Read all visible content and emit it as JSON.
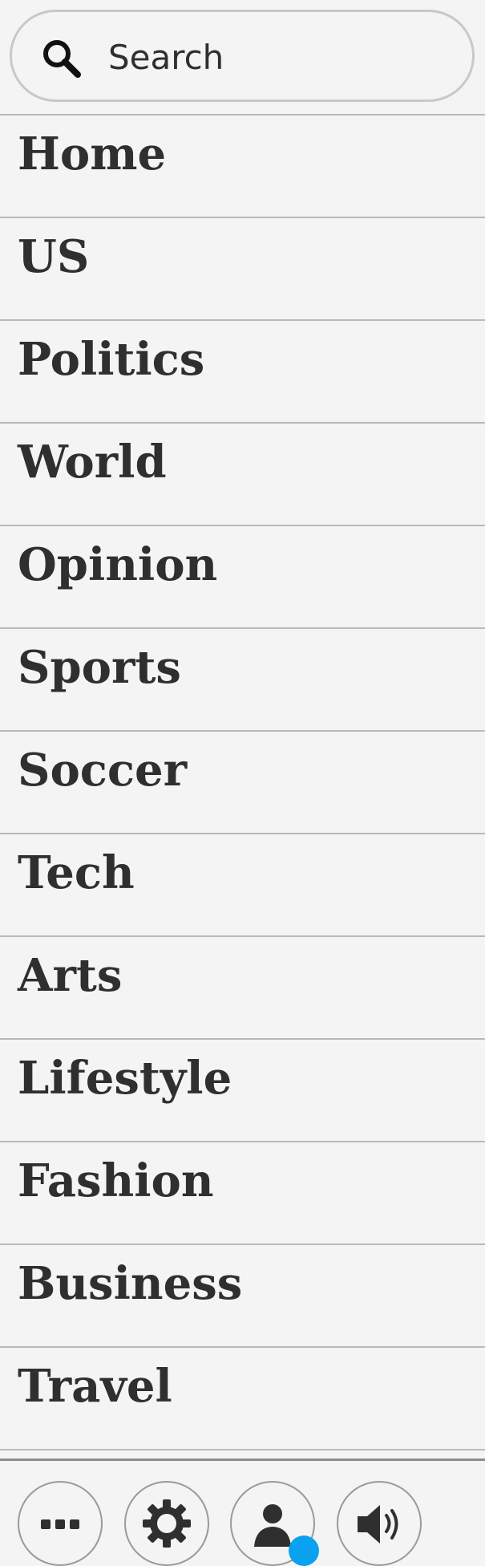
{
  "search": {
    "placeholder": "Search",
    "value": "",
    "icon": "search-icon"
  },
  "nav": {
    "items": [
      {
        "label": "Home"
      },
      {
        "label": "US"
      },
      {
        "label": "Politics"
      },
      {
        "label": "World"
      },
      {
        "label": "Opinion"
      },
      {
        "label": "Sports"
      },
      {
        "label": "Soccer"
      },
      {
        "label": "Tech"
      },
      {
        "label": "Arts"
      },
      {
        "label": "Lifestyle"
      },
      {
        "label": "Fashion"
      },
      {
        "label": "Business"
      },
      {
        "label": "Travel"
      }
    ]
  },
  "toolbar": {
    "buttons": [
      {
        "icon": "more-icon"
      },
      {
        "icon": "gear-icon"
      },
      {
        "icon": "user-icon",
        "badge_color": "#0aa2ee"
      },
      {
        "icon": "speaker-icon"
      }
    ]
  },
  "colors": {
    "background": "#f4f4f4",
    "text": "#2f2f2f",
    "divider": "#b9b9b9",
    "badge": "#0aa2ee"
  }
}
